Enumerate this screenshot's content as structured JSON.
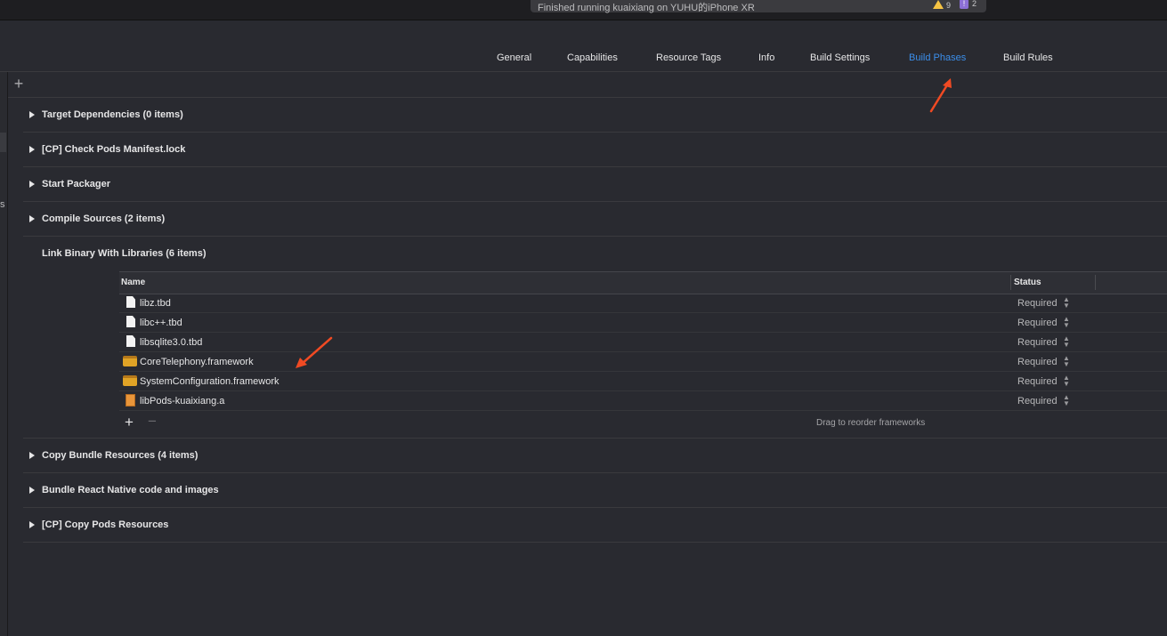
{
  "status_bar": {
    "message": "Finished running kuaixiang on YUHU的iPhone XR",
    "warnings": "9",
    "errors_badge": "!",
    "errors": "2"
  },
  "tabs": [
    {
      "label": "General"
    },
    {
      "label": "Capabilities"
    },
    {
      "label": "Resource Tags"
    },
    {
      "label": "Info"
    },
    {
      "label": "Build Settings"
    },
    {
      "label": "Build Phases",
      "active": true
    },
    {
      "label": "Build Rules"
    }
  ],
  "left_strip": {
    "fragment": "s"
  },
  "phases": [
    {
      "label": "Target Dependencies (0 items)"
    },
    {
      "label": "[CP] Check Pods Manifest.lock"
    },
    {
      "label": "Start Packager"
    },
    {
      "label": "Compile Sources (2 items)"
    },
    {
      "label": "Link Binary With Libraries (6 items)",
      "expanded": true
    },
    {
      "label": "Copy Bundle Resources (4 items)"
    },
    {
      "label": "Bundle React Native code and images"
    },
    {
      "label": "[CP] Copy Pods Resources"
    }
  ],
  "libraries": {
    "columns": {
      "name": "Name",
      "status": "Status"
    },
    "rows": [
      {
        "name": "libz.tbd",
        "status": "Required",
        "icon": "file-icon"
      },
      {
        "name": "libc++.tbd",
        "status": "Required",
        "icon": "file-icon"
      },
      {
        "name": "libsqlite3.0.tbd",
        "status": "Required",
        "icon": "file-icon"
      },
      {
        "name": "CoreTelephony.framework",
        "status": "Required",
        "icon": "toolbox-icon"
      },
      {
        "name": "SystemConfiguration.framework",
        "status": "Required",
        "icon": "toolbox-icon"
      },
      {
        "name": "libPods-kuaixiang.a",
        "status": "Required",
        "icon": "static-library-icon"
      }
    ],
    "footer_hint": "Drag to reorder frameworks"
  },
  "colors": {
    "accent": "#3b8eea",
    "annotation_arrow": "#f04a23"
  }
}
